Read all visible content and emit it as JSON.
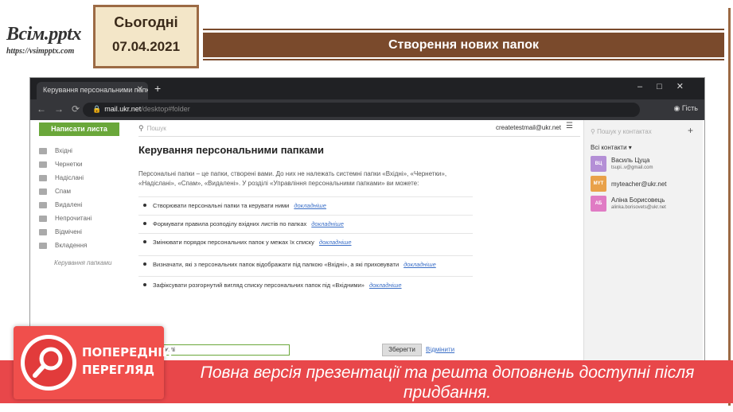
{
  "slide": {
    "logo_main": "Всім.pptx",
    "logo_url": "https://vsimpptx.com",
    "date_label": "Сьогодні",
    "date_value": "07.04.2021",
    "title": "Створення нових папок"
  },
  "browser": {
    "tab_title": "Керування персональними папк",
    "url_host": "mail.ukr.net",
    "url_path": "/desktop#folder",
    "profile_label": "Гість"
  },
  "mail": {
    "write_button": "Написати листа",
    "folders": [
      "Вхідні",
      "Чернетки",
      "Надіслані",
      "Спам",
      "Видалені",
      "Непрочитані",
      "Відмічені",
      "Вкладення"
    ],
    "manage_folders": "Керування папками",
    "search_placeholder": "Пошук",
    "account_email": "createtestmail@ukr.net",
    "heading": "Керування персональними папками",
    "intro": "Персональні папки – це папки, створені вами. До них не належать системні папки «Вхідні», «Чернетки», «Надіслані», «Спам», «Видалені». У розділі «Управління персональними папками» ви можете:",
    "items": [
      {
        "text": "Створювати персональні папки та керувати ними",
        "link": "докладніше"
      },
      {
        "text": "Формувати правила розподілу вхідних листів по папках",
        "link": "докладніше"
      },
      {
        "text": "Змінювати порядок персональних папок у межах їх списку",
        "link": "докладніше"
      },
      {
        "text": "Визначати, які з персональних папок відображати під папкою «Вхідні», а які приховувати",
        "link": "докладніше"
      },
      {
        "text": "Зафіксувати розгорнутий вигляд списку персональних папок під «Вхідними»",
        "link": "докладніше"
      }
    ],
    "input_value": "и та паролі",
    "save_button": "Зберегти",
    "cancel_button": "Відмінити"
  },
  "contacts": {
    "search_placeholder": "Пошук у контактах",
    "all_contacts": "Всі контакти ▾",
    "list": [
      {
        "initials": "ВЦ",
        "name": "Василь Цуца",
        "email": "tsupi..v@gmail.com",
        "color": "#b48fd6"
      },
      {
        "initials": "MYT",
        "name": "myteacher@ukr.net",
        "email": "",
        "color": "#e9a14a"
      },
      {
        "initials": "АБ",
        "name": "Аліна Борисовець",
        "email": "alinka.borisovets@ukr.net",
        "color": "#e07bc4"
      }
    ]
  },
  "banner": {
    "preview_line1": "ПОПЕРЕДНІЙ",
    "preview_line2": "ПЕРЕГЛЯД",
    "text": "Повна версія презентації та решта доповнень доступні після придбання."
  },
  "colors": {
    "accent_brown": "#7a4a2c",
    "banner_red": "#e8474a",
    "mail_green": "#6aa73a"
  }
}
